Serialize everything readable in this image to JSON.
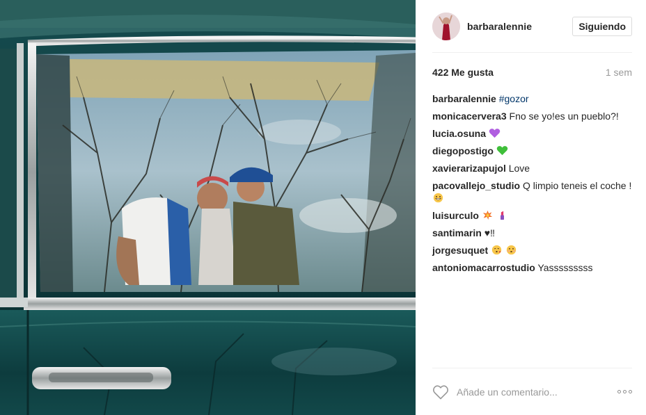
{
  "post": {
    "author": "barbaralennie",
    "follow_label": "Siguiendo",
    "likes": "422 Me gusta",
    "time": "1 sem"
  },
  "comments": [
    {
      "user": "barbaralennie",
      "text": "",
      "tag": "#gozor"
    },
    {
      "user": "monicacervera3",
      "text": "Fno se yo!es un pueblo?!"
    },
    {
      "user": "lucia.osuna",
      "text": "",
      "emoji": "purple-heart"
    },
    {
      "user": "diegopostigo",
      "text": "",
      "emoji": "green-heart"
    },
    {
      "user": "xavierarizapujol",
      "text": "Love"
    },
    {
      "user": "pacovallejo_studio",
      "text": "Q limpio teneis el coche !",
      "emoji": "grinning-face"
    },
    {
      "user": "luisurculo",
      "text": "",
      "emoji": "collision-and-lipstick"
    },
    {
      "user": "santimarin",
      "text": "♥‼"
    },
    {
      "user": "jorgesuquet",
      "text": "",
      "emoji": "kissing-faces"
    },
    {
      "user": "antoniomacarrostudio",
      "text": "Yasssssssss"
    }
  ],
  "footer": {
    "comment_placeholder": "Añade un comentario..."
  },
  "icons": {
    "like": "heart-outline-icon",
    "more": "ellipsis-icon"
  },
  "colors": {
    "hashtag": "#003569",
    "muted": "#999999",
    "divider": "#efefef"
  }
}
